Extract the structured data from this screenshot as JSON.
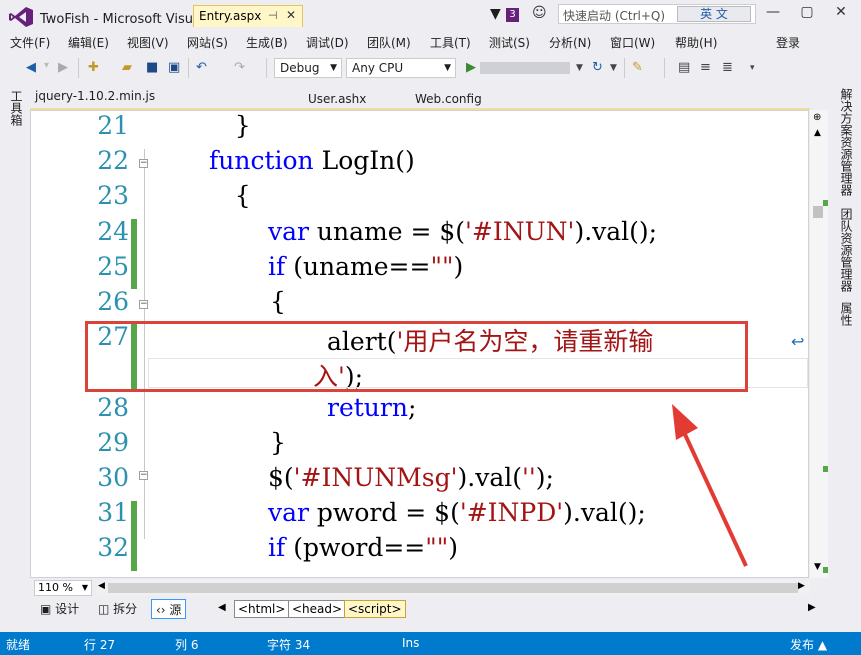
{
  "window": {
    "title": "TwoFish - Microsoft Visual Studio(管理员)",
    "notification_count": "3",
    "quick_launch_placeholder": "快速启动 (Ctrl+Q)",
    "ime_label": "英 文",
    "buttons": [
      "—",
      "▢",
      "✕"
    ]
  },
  "menu": {
    "items": [
      "文件(F)",
      "编辑(E)",
      "视图(V)",
      "网站(S)",
      "生成(B)",
      "调试(D)",
      "团队(M)",
      "工具(T)",
      "测试(S)",
      "分析(N)",
      "窗口(W)",
      "帮助(H)"
    ],
    "login": "登录"
  },
  "toolbar": {
    "config": "Debug",
    "platform": "Any CPU"
  },
  "left_strip": {
    "label": "工具箱"
  },
  "tabs": [
    {
      "label": "jquery-1.10.2.min.js"
    },
    {
      "label": "Entry.aspx",
      "pin": "⊣",
      "close": "✕"
    },
    {
      "label": "User.ashx"
    },
    {
      "label": "Web.config"
    }
  ],
  "code_lines": [
    {
      "n": "21",
      "text": "    }"
    },
    {
      "n": "22",
      "kw": "function",
      "text": " LogIn()"
    },
    {
      "n": "23",
      "text": "    {"
    },
    {
      "n": "24",
      "kw": "var",
      "text": " uname = $(",
      "str": "'#INUN'",
      "tail": ").val();"
    },
    {
      "n": "25",
      "kw": "if",
      "text": " (uname==",
      "str": "\"\"",
      "tail": ")"
    },
    {
      "n": "26",
      "text": "{"
    },
    {
      "n": "27",
      "text": "alert(",
      "str": "'用户名为空，请重新输"
    },
    {
      "n": "",
      "str": "入'",
      "tail": ");"
    },
    {
      "n": "28",
      "kw": "return",
      "tail": ";"
    },
    {
      "n": "29",
      "text": "}"
    },
    {
      "n": "30",
      "text": "$(",
      "str": "'#INUNMsg'",
      "tail": ").val(",
      "str2": "''",
      "tail2": ");"
    },
    {
      "n": "31",
      "kw": "var",
      "text": " pword = $(",
      "str": "'#INPD'",
      "tail": ").val();"
    },
    {
      "n": "32",
      "kw": "if",
      "text": " (pword==",
      "str": "\"\"",
      "tail": ")"
    }
  ],
  "zoom": "110 %",
  "bottom": {
    "design": "设计",
    "split": "拆分",
    "source": "源",
    "crumbs": [
      "<html>",
      "<head>",
      "<script>"
    ]
  },
  "right_strip": {
    "labels": [
      "解决方案资源管理器",
      "团队资源管理器",
      "属性"
    ]
  },
  "status": {
    "ready": "就绪",
    "line": "行 27",
    "col": "列 6",
    "char": "字符 34",
    "mode": "Ins",
    "publish": "发布 ▲"
  },
  "colors": {
    "accent": "#007acc",
    "highlight": "#d9433a",
    "keyword": "#0000ff",
    "string": "#a31515",
    "line_number": "#2b91af"
  }
}
